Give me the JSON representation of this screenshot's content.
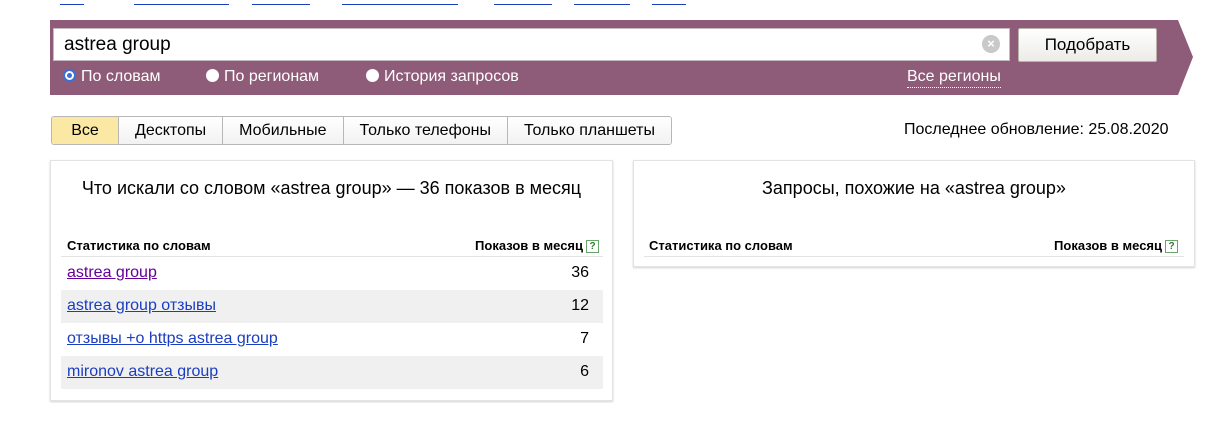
{
  "search": {
    "query": "astrea group",
    "submit_label": "Подобрать",
    "modes": [
      {
        "label": "По словам",
        "selected": true
      },
      {
        "label": "По регионам",
        "selected": false
      },
      {
        "label": "История запросов",
        "selected": false
      }
    ],
    "regions_link": "Все регионы"
  },
  "device_tabs": [
    "Все",
    "Десктопы",
    "Мобильные",
    "Только телефоны",
    "Только планшеты"
  ],
  "active_tab": "Все",
  "last_update": "Последнее обновление: 25.08.2020",
  "words_panel": {
    "title": "Что искали со словом «astrea group» — 36 показов в месяц",
    "col_phrase": "Статистика по словам",
    "col_count": "Показов в месяц",
    "help": "?",
    "rows": [
      {
        "phrase": "astrea group",
        "count": "36",
        "visited": true
      },
      {
        "phrase": "astrea group отзывы",
        "count": "12",
        "visited": false
      },
      {
        "phrase": "отзывы +о https astrea group",
        "count": "7",
        "visited": false
      },
      {
        "phrase": "mironov astrea group",
        "count": "6",
        "visited": false
      }
    ]
  },
  "similar_panel": {
    "title": "Запросы, похожие на «astrea group»",
    "col_phrase": "Статистика по словам",
    "col_count": "Показов в месяц",
    "help": "?"
  },
  "colors": {
    "band": "#8e5c78",
    "link": "#1a3dc1",
    "visited_link": "#660099",
    "active_tab": "#fbe8a4"
  }
}
